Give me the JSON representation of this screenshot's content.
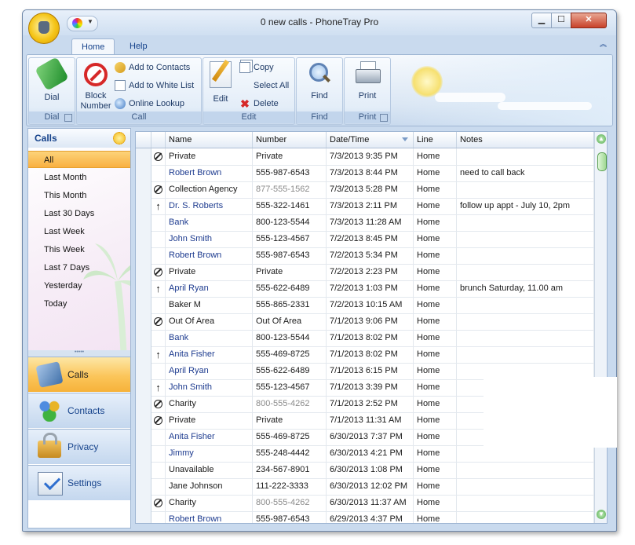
{
  "window": {
    "title": "0 new calls - PhoneTray Pro",
    "min_label": "▁",
    "max_label": "☐",
    "close_label": "✕"
  },
  "tabs": [
    "Home",
    "Help"
  ],
  "ribbon": {
    "dial_group": {
      "button": "Dial",
      "label": "Dial"
    },
    "call_group": {
      "label": "Call",
      "block_line1": "Block",
      "block_line2": "Number",
      "add_contacts": "Add to Contacts",
      "add_white_list": "Add to White List",
      "online_lookup": "Online Lookup"
    },
    "edit_group": {
      "label": "Edit",
      "edit": "Edit",
      "copy": "Copy",
      "select_all": "Select All",
      "delete": "Delete"
    },
    "find_group": {
      "button": "Find",
      "label": "Find"
    },
    "print_group": {
      "button": "Print",
      "label": "Print"
    }
  },
  "sidebar": {
    "title": "Calls",
    "filters": [
      "All",
      "Last Month",
      "This Month",
      "Last 30 Days",
      "Last Week",
      "This Week",
      "Last 7 Days",
      "Yesterday",
      "Today"
    ],
    "active_filter": "All",
    "splitter": "•••••",
    "nav": [
      {
        "label": "Calls",
        "icon": "phone-icon",
        "active": true
      },
      {
        "label": "Contacts",
        "icon": "contacts-icon",
        "active": false
      },
      {
        "label": "Privacy",
        "icon": "lock-icon",
        "active": false
      },
      {
        "label": "Settings",
        "icon": "settings-icon",
        "active": false
      }
    ]
  },
  "grid": {
    "columns": [
      "Name",
      "Number",
      "Date/Time",
      "Line",
      "Notes"
    ],
    "sorted_column": "Date/Time",
    "rows": [
      {
        "icon": "blocked",
        "name": "Private",
        "number": "Private",
        "datetime": "7/3/2013 9:35 PM",
        "line": "Home",
        "notes": "",
        "known": false,
        "number_gray": false
      },
      {
        "icon": "",
        "name": "Robert Brown",
        "number": "555-987-6543",
        "datetime": "7/3/2013 8:44 PM",
        "line": "Home",
        "notes": "need to call back",
        "known": true,
        "number_gray": false
      },
      {
        "icon": "blocked",
        "name": "Collection Agency",
        "number": "877-555-1562",
        "datetime": "7/3/2013 5:28 PM",
        "line": "Home",
        "notes": "",
        "known": false,
        "number_gray": true
      },
      {
        "icon": "outgoing",
        "name": "Dr. S. Roberts",
        "number": "555-322-1461",
        "datetime": "7/3/2013 2:11 PM",
        "line": "Home",
        "notes": "follow up appt - July 10, 2pm",
        "known": true,
        "number_gray": false
      },
      {
        "icon": "",
        "name": "Bank",
        "number": "800-123-5544",
        "datetime": "7/3/2013 11:28 AM",
        "line": "Home",
        "notes": "",
        "known": true,
        "number_gray": false
      },
      {
        "icon": "",
        "name": "John Smith",
        "number": "555-123-4567",
        "datetime": "7/2/2013 8:45 PM",
        "line": "Home",
        "notes": "",
        "known": true,
        "number_gray": false
      },
      {
        "icon": "",
        "name": "Robert Brown",
        "number": "555-987-6543",
        "datetime": "7/2/2013 5:34 PM",
        "line": "Home",
        "notes": "",
        "known": true,
        "number_gray": false
      },
      {
        "icon": "blocked",
        "name": "Private",
        "number": "Private",
        "datetime": "7/2/2013 2:23 PM",
        "line": "Home",
        "notes": "",
        "known": false,
        "number_gray": false
      },
      {
        "icon": "outgoing",
        "name": "April Ryan",
        "number": "555-622-6489",
        "datetime": "7/2/2013 1:03 PM",
        "line": "Home",
        "notes": "brunch Saturday, 11.00 am",
        "known": true,
        "number_gray": false
      },
      {
        "icon": "",
        "name": "Baker M",
        "number": "555-865-2331",
        "datetime": "7/2/2013 10:15 AM",
        "line": "Home",
        "notes": "",
        "known": false,
        "number_gray": false
      },
      {
        "icon": "blocked",
        "name": "Out Of Area",
        "number": "Out Of Area",
        "datetime": "7/1/2013 9:06 PM",
        "line": "Home",
        "notes": "",
        "known": false,
        "number_gray": false
      },
      {
        "icon": "",
        "name": "Bank",
        "number": "800-123-5544",
        "datetime": "7/1/2013 8:02 PM",
        "line": "Home",
        "notes": "",
        "known": true,
        "number_gray": false
      },
      {
        "icon": "outgoing",
        "name": "Anita Fisher",
        "number": "555-469-8725",
        "datetime": "7/1/2013 8:02 PM",
        "line": "Home",
        "notes": "",
        "known": true,
        "number_gray": false
      },
      {
        "icon": "",
        "name": "April Ryan",
        "number": "555-622-6489",
        "datetime": "7/1/2013 6:15 PM",
        "line": "Home",
        "notes": "",
        "known": true,
        "number_gray": false
      },
      {
        "icon": "outgoing",
        "name": "John Smith",
        "number": "555-123-4567",
        "datetime": "7/1/2013 3:39 PM",
        "line": "Home",
        "notes": "",
        "known": true,
        "number_gray": false
      },
      {
        "icon": "blocked",
        "name": "Charity",
        "number": "800-555-4262",
        "datetime": "7/1/2013 2:52 PM",
        "line": "Home",
        "notes": "",
        "known": false,
        "number_gray": true
      },
      {
        "icon": "blocked",
        "name": "Private",
        "number": "Private",
        "datetime": "7/1/2013 11:31 AM",
        "line": "Home",
        "notes": "",
        "known": false,
        "number_gray": false
      },
      {
        "icon": "",
        "name": "Anita Fisher",
        "number": "555-469-8725",
        "datetime": "6/30/2013 7:37 PM",
        "line": "Home",
        "notes": "",
        "known": true,
        "number_gray": false
      },
      {
        "icon": "",
        "name": "Jimmy",
        "number": "555-248-4442",
        "datetime": "6/30/2013 4:21 PM",
        "line": "Home",
        "notes": "",
        "known": true,
        "number_gray": false
      },
      {
        "icon": "",
        "name": "Unavailable",
        "number": "234-567-8901",
        "datetime": "6/30/2013 1:08 PM",
        "line": "Home",
        "notes": "",
        "known": false,
        "number_gray": false
      },
      {
        "icon": "",
        "name": "Jane Johnson",
        "number": "111-222-3333",
        "datetime": "6/30/2013 12:02 PM",
        "line": "Home",
        "notes": "",
        "known": false,
        "number_gray": false
      },
      {
        "icon": "blocked",
        "name": "Charity",
        "number": "800-555-4262",
        "datetime": "6/30/2013 11:37 AM",
        "line": "Home",
        "notes": "",
        "known": false,
        "number_gray": true
      },
      {
        "icon": "",
        "name": "Robert Brown",
        "number": "555-987-6543",
        "datetime": "6/29/2013 4:37 PM",
        "line": "Home",
        "notes": "",
        "known": true,
        "number_gray": false
      }
    ]
  },
  "colors": {
    "accent": "#15428b",
    "known_contact": "#1d3b8f",
    "active_orange": "#f9b041"
  }
}
